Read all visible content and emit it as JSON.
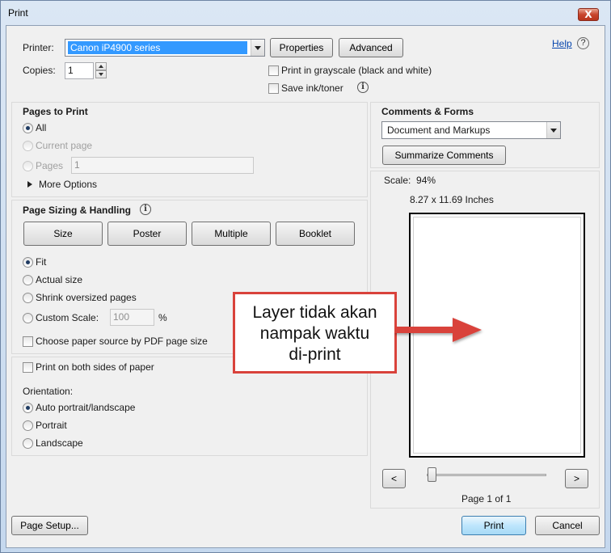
{
  "window": {
    "title": "Print",
    "close_glyph": "X"
  },
  "printer": {
    "label": "Printer:",
    "selected": "Canon iP4900 series",
    "properties_label": "Properties",
    "advanced_label": "Advanced",
    "help_label": "Help"
  },
  "copies": {
    "label": "Copies:",
    "value": "1"
  },
  "options": {
    "grayscale_label": "Print in grayscale (black and white)",
    "save_ink_label": "Save ink/toner"
  },
  "pages_to_print": {
    "title": "Pages to Print",
    "all_label": "All",
    "current_label": "Current page",
    "pages_label": "Pages",
    "pages_value": "1",
    "more_options_label": "More Options"
  },
  "sizing": {
    "title": "Page Sizing & Handling",
    "tabs": [
      "Size",
      "Poster",
      "Multiple",
      "Booklet"
    ],
    "fit_label": "Fit",
    "actual_label": "Actual size",
    "shrink_label": "Shrink oversized pages",
    "custom_label": "Custom Scale:",
    "custom_value": "100",
    "percent": "%",
    "paper_source_label": "Choose paper source by PDF page size"
  },
  "duplex": {
    "label": "Print on both sides of paper"
  },
  "orientation": {
    "title": "Orientation:",
    "auto_label": "Auto portrait/landscape",
    "portrait_label": "Portrait",
    "landscape_label": "Landscape"
  },
  "comments": {
    "title": "Comments & Forms",
    "selected": "Document and Markups",
    "summarize_label": "Summarize Comments"
  },
  "preview": {
    "scale_label": "Scale:",
    "scale_value": "94%",
    "dimensions": "8.27 x 11.69 Inches",
    "prev_label": "<",
    "next_label": ">",
    "page_info": "Page 1 of 1",
    "slider_position": 0
  },
  "annotation": {
    "line1": "Layer tidak akan",
    "line2": "nampak waktu",
    "line3": "di-print",
    "color": "#d9423b"
  },
  "footer": {
    "page_setup_label": "Page Setup...",
    "print_label": "Print",
    "cancel_label": "Cancel"
  }
}
